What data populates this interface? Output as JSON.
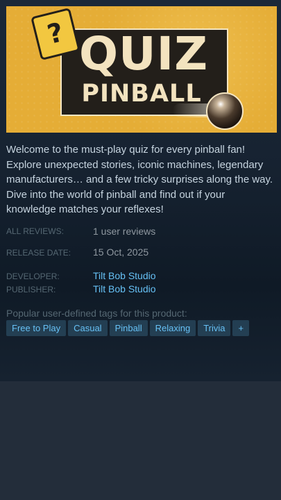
{
  "capsule": {
    "badge": "?",
    "logo_line1": "QUIZ",
    "logo_line2": "PINBALL"
  },
  "description": "Welcome to the must-play quiz for every pinball fan! Explore unexpected stories, iconic machines, legendary manufacturers… and a few tricky surprises along the way. Dive into the world of pinball and find out if your knowledge matches your reflexes!",
  "info": {
    "reviews_label": "ALL REVIEWS:",
    "reviews_value": "1 user reviews",
    "release_label": "RELEASE DATE:",
    "release_value": "15 Oct, 2025",
    "developer_label": "DEVELOPER:",
    "developer_value": "Tilt Bob Studio",
    "publisher_label": "PUBLISHER:",
    "publisher_value": "Tilt Bob Studio"
  },
  "tags": {
    "title": "Popular user-defined tags for this product:",
    "items": [
      "Free to Play",
      "Casual",
      "Pinball",
      "Relaxing",
      "Trivia",
      "+"
    ]
  },
  "colors": {
    "background": "#1b2838",
    "link": "#66c0f4",
    "tag_text": "#67c1f5",
    "capsule": "#e5ad36"
  }
}
